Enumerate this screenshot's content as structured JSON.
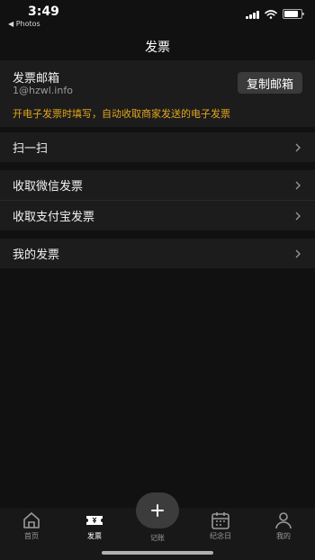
{
  "status_bar": {
    "time": "3:49",
    "back_app": "◀ Photos"
  },
  "nav": {
    "title": "发票"
  },
  "email_card": {
    "label": "发票邮箱",
    "email": "1@hzwl.info",
    "copy_button": "复制邮箱",
    "hint": "开电子发票时填写，自动收取商家发送的电子发票"
  },
  "menu": {
    "scan": "扫一扫",
    "wechat_invoice": "收取微信发票",
    "alipay_invoice": "收取支付宝发票",
    "my_invoices": "我的发票"
  },
  "tab_bar": {
    "home": "首页",
    "invoice": "发票",
    "add": "记账",
    "anniversary": "纪念日",
    "mine": "我的"
  },
  "colors": {
    "accent": "#e3a61c",
    "background": "#111111",
    "card": "#1c1c1c"
  }
}
